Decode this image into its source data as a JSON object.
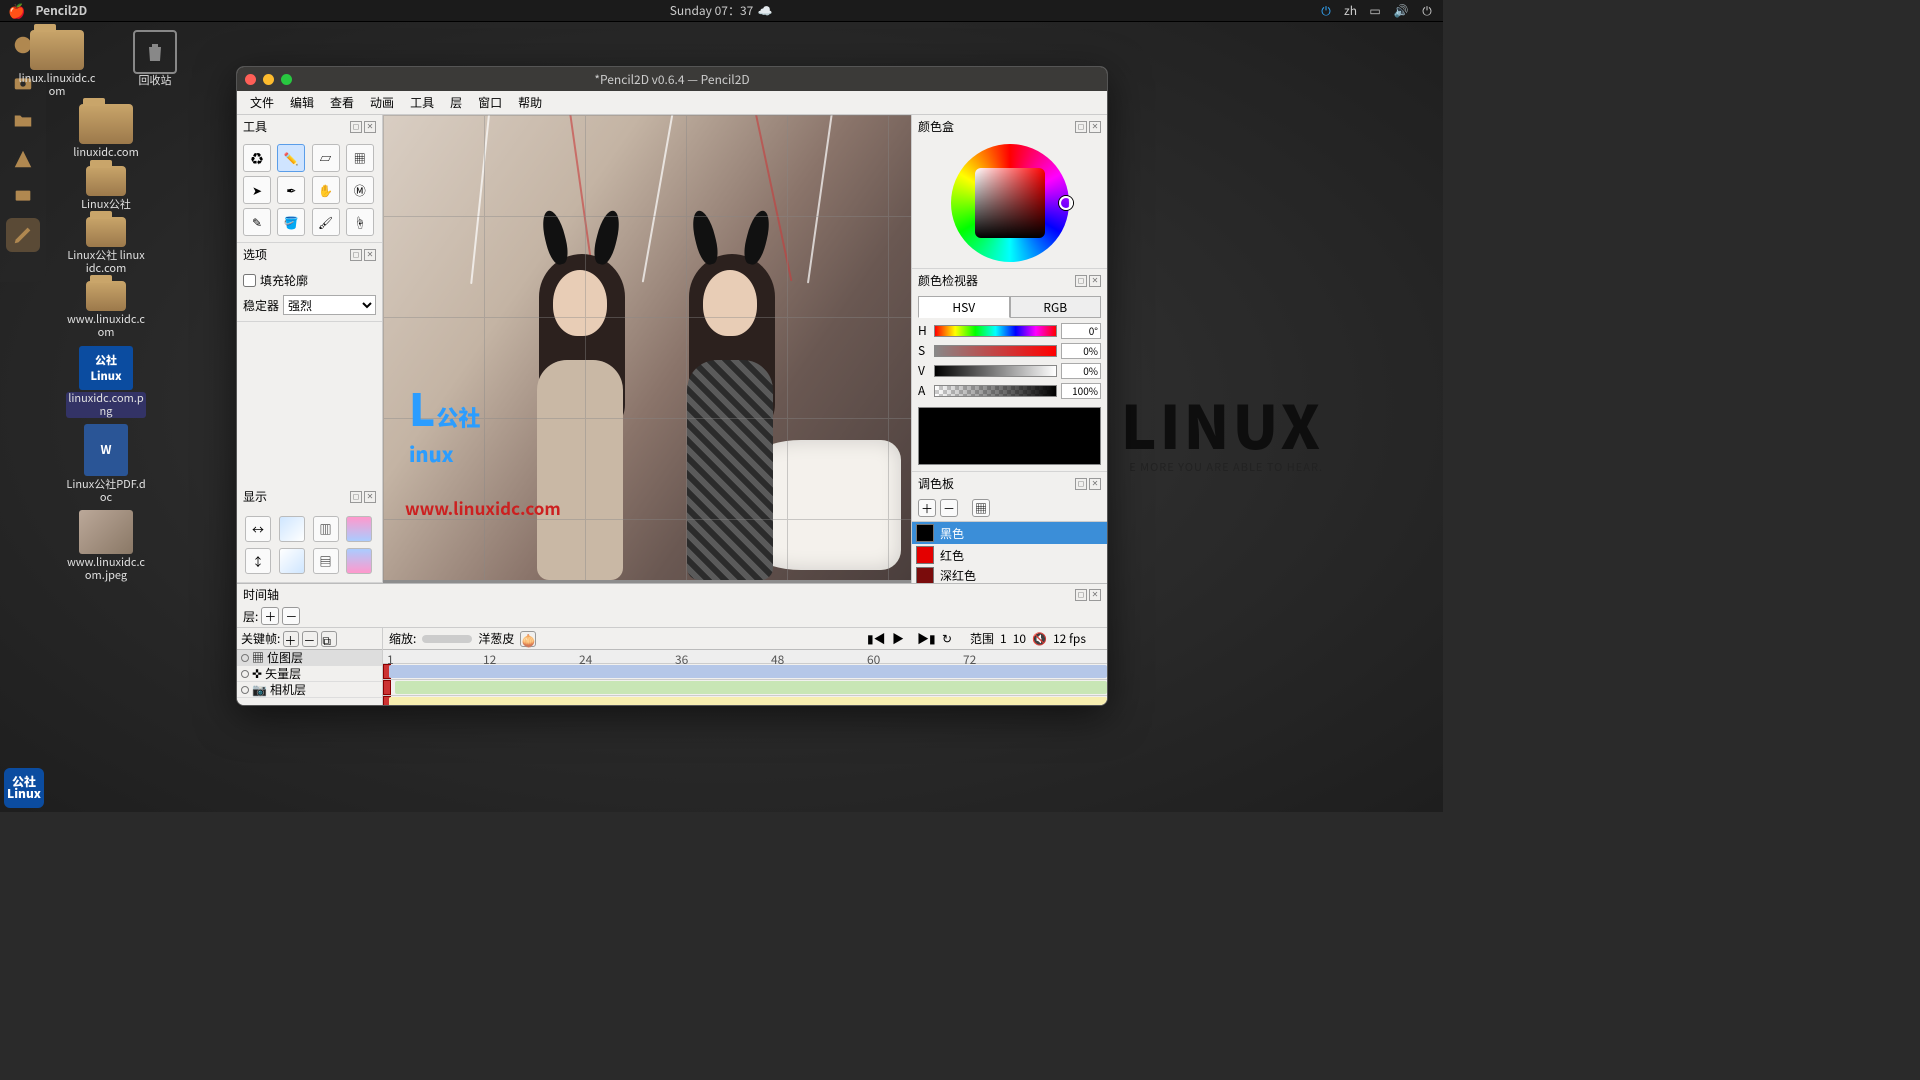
{
  "topbar": {
    "app": "Pencil2D",
    "clock": "Sunday 07：37",
    "lang": "zh"
  },
  "desktop": {
    "trash": "回收站",
    "icons": [
      "linux.linuxidc.com",
      "linuxidc.com",
      "Linux公社",
      "Linux公社 linuxidc.com",
      "www.linuxidc.com",
      "linuxidc.com.png",
      "Linux公社PDF.doc",
      "www.linuxidc.com.jpeg"
    ]
  },
  "watermark": {
    "big": "LINUX",
    "sub": "E MORE YOU ARE ABLE TO HEAR."
  },
  "window": {
    "title": "*Pencil2D v0.6.4 — Pencil2D",
    "menu": [
      "文件",
      "编辑",
      "查看",
      "动画",
      "工具",
      "层",
      "窗口",
      "帮助"
    ]
  },
  "panels": {
    "tools": "工具",
    "options": "选项",
    "display": "显示",
    "colorbox": "颜色盒",
    "colorinspector": "颜色检视器",
    "palette": "调色板",
    "timeline": "时间轴"
  },
  "options": {
    "fill": "填充轮廓",
    "stabilizer": "稳定器",
    "stabilizer_value": "强烈"
  },
  "colorinspector": {
    "tabs": [
      "HSV",
      "RGB"
    ],
    "h": {
      "label": "H",
      "val": "0°"
    },
    "s": {
      "label": "S",
      "val": "0%"
    },
    "v": {
      "label": "V",
      "val": "0%"
    },
    "a": {
      "label": "A",
      "val": "100%"
    }
  },
  "palette": {
    "items": [
      {
        "name": "黑色",
        "color": "#000000"
      },
      {
        "name": "红色",
        "color": "#e40000"
      },
      {
        "name": "深红色",
        "color": "#7a0c0c"
      }
    ]
  },
  "timeline": {
    "layer_label": "层:",
    "keyframe": "关键帧:",
    "zoom": "缩放:",
    "onion": "洋葱皮",
    "range": "范围",
    "range_from": "1",
    "range_to": "10",
    "fps": "12 fps",
    "ticks": [
      "1",
      "12",
      "24",
      "36",
      "48",
      "60",
      "72"
    ],
    "layers": [
      "位图层",
      "矢量层",
      "相机层"
    ]
  },
  "canvas": {
    "logo_big": "L",
    "logo_sub": "公社",
    "logo_small": "inux",
    "url": "www.linuxidc.com"
  },
  "launcher": "公社\nLinux"
}
